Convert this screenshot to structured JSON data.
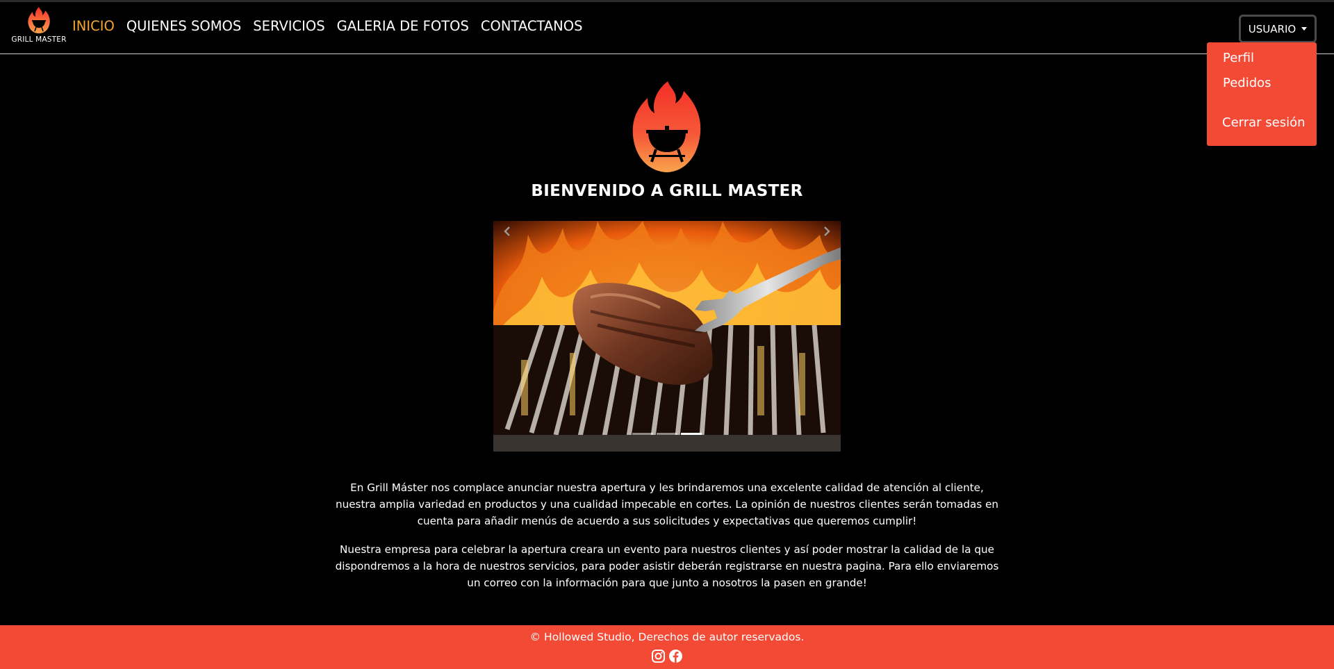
{
  "brand": {
    "name": "GRILL MASTER"
  },
  "nav": {
    "items": [
      {
        "label": "INICIO",
        "active": true
      },
      {
        "label": "QUIENES SOMOS",
        "active": false
      },
      {
        "label": "SERVICIOS",
        "active": false
      },
      {
        "label": "GALERIA DE FOTOS",
        "active": false
      },
      {
        "label": "CONTACTANOS",
        "active": false
      }
    ]
  },
  "user_menu": {
    "button_label": "USUARIO",
    "items": [
      {
        "label": "Perfil"
      },
      {
        "label": "Pedidos"
      },
      {
        "label": "Cerrar sesión"
      }
    ]
  },
  "hero": {
    "title": "BIENVENIDO A GRILL MASTER"
  },
  "carousel": {
    "slide_count": 3,
    "active_index": 2,
    "prev_icon": "chevron-left-icon",
    "next_icon": "chevron-right-icon"
  },
  "about": {
    "paragraphs": [
      "En Grill Máster nos complace anunciar nuestra apertura y les brindaremos una excelente calidad de atención al cliente, nuestra amplia variedad en productos y una cualidad impecable en cortes. La opinión de nuestros clientes serán tomadas en cuenta para añadir menús de acuerdo a sus solicitudes y expectativas que queremos cumplir!",
      "Nuestra empresa para celebrar la apertura creara un evento para nuestros clientes y así poder mostrar la calidad de la que dispondremos a la hora de nuestros servicios, para poder asistir deberán registrarse en nuestra pagina. Para ello enviaremos un correo con la información para que junto a nosotros la pasen en grande!"
    ]
  },
  "footer": {
    "copyright": "© Hollowed Studio, Derechos de autor reservados.",
    "social": [
      "instagram-icon",
      "facebook-icon"
    ]
  },
  "colors": {
    "accent_nav_active": "#f7a531",
    "brand_red": "#f34a36",
    "background": "#000000"
  }
}
